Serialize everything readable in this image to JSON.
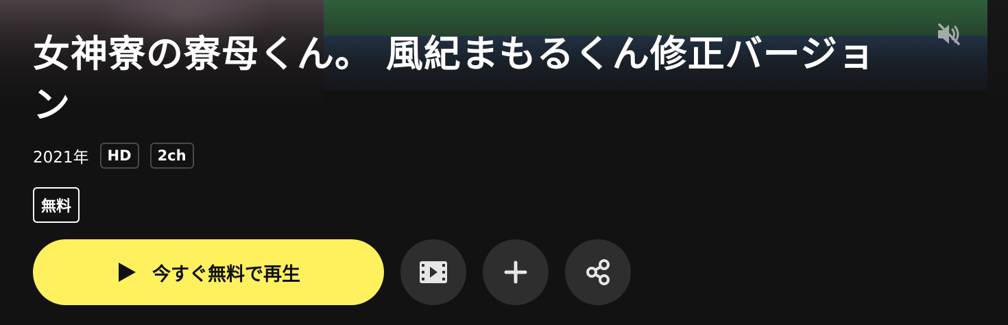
{
  "title": "女神寮の寮母くん。 風紀まもるくん修正バージョン",
  "meta": {
    "year": "2021年",
    "quality": "HD",
    "audio": "2ch"
  },
  "free_badge": "無料",
  "actions": {
    "play_label": "今すぐ無料で再生"
  },
  "colors": {
    "background": "#121212",
    "accent": "#fff15e",
    "round_button": "#2e2e2e",
    "badge_border": "#4a4a4a"
  },
  "icons": {
    "mute": "volume-mute-icon",
    "play": "play-icon",
    "trailer": "film-icon",
    "add": "plus-icon",
    "share": "share-icon"
  }
}
